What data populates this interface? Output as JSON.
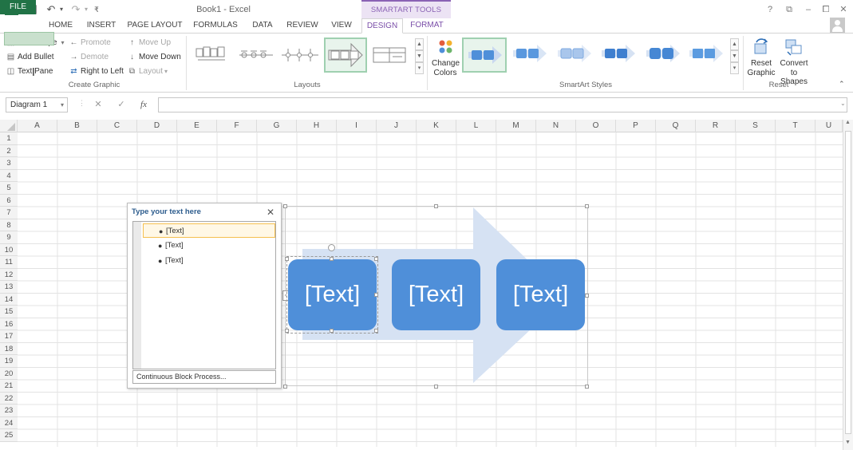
{
  "app": {
    "title": "Book1 - Excel",
    "context_tab_header": "SMARTART TOOLS"
  },
  "window_controls": [
    "?",
    "⧉",
    "–",
    "⧠",
    "✕"
  ],
  "tabs": [
    {
      "label": "FILE"
    },
    {
      "label": "HOME"
    },
    {
      "label": "INSERT"
    },
    {
      "label": "PAGE LAYOUT"
    },
    {
      "label": "FORMULAS"
    },
    {
      "label": "DATA"
    },
    {
      "label": "REVIEW"
    },
    {
      "label": "VIEW"
    },
    {
      "label": "DESIGN"
    },
    {
      "label": "FORMAT"
    }
  ],
  "ribbon": {
    "create_graphic": {
      "label": "Create Graphic",
      "add_shape": "Add Shape",
      "add_bullet": "Add Bullet",
      "text_pane": "Text Pane",
      "promote": "Promote",
      "demote": "Demote",
      "right_to_left": "Right to Left",
      "move_up": "Move Up",
      "move_down": "Move Down",
      "layout": "Layout"
    },
    "layouts": {
      "label": "Layouts"
    },
    "smartart_styles": {
      "label": "SmartArt Styles",
      "change_colors_1": "Change",
      "change_colors_2": "Colors"
    },
    "reset": {
      "label": "Reset",
      "reset_graphic_1": "Reset",
      "reset_graphic_2": "Graphic",
      "convert_1": "Convert",
      "convert_2": "to Shapes"
    }
  },
  "formula_bar": {
    "name_box": "Diagram 1",
    "fx": "fx",
    "cancel": "✕",
    "enter": "✓"
  },
  "grid": {
    "columns": [
      "A",
      "B",
      "C",
      "D",
      "E",
      "F",
      "G",
      "H",
      "I",
      "J",
      "K",
      "L",
      "M",
      "N",
      "O",
      "P",
      "Q",
      "R",
      "S",
      "T",
      "U"
    ],
    "rows": [
      "1",
      "2",
      "3",
      "4",
      "5",
      "6",
      "7",
      "8",
      "9",
      "10",
      "11",
      "12",
      "13",
      "14",
      "15",
      "16",
      "17",
      "18",
      "19",
      "20",
      "21",
      "22",
      "23",
      "24",
      "25"
    ]
  },
  "text_pane": {
    "title": "Type your text here",
    "items": [
      "[Text]",
      "[Text]",
      "[Text]"
    ],
    "footer": "Continuous Block Process..."
  },
  "smartart": {
    "boxes": [
      "[Text]",
      "[Text]",
      "[Text]"
    ]
  },
  "colors": {
    "excel_green": "#217346",
    "smartart_purple": "#7a4ea8",
    "shape_blue": "#4f8fd9",
    "arrow_light_blue": "#d6e2f3"
  }
}
